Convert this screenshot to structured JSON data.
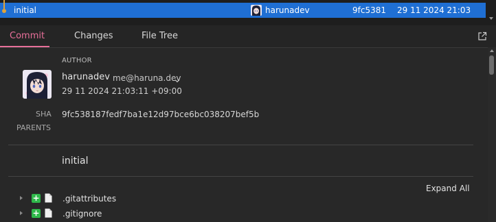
{
  "commit_row": {
    "subject": "initial",
    "author": "harunadev",
    "sha_short": "9fc5381",
    "date": "29 11 2024 21:03",
    "graph_color": "#e0a33a",
    "selection_color": "#1f6fd4"
  },
  "tabs": [
    {
      "label": "Commit",
      "active": true
    },
    {
      "label": "Changes",
      "active": false
    },
    {
      "label": "File Tree",
      "active": false
    }
  ],
  "accent_color": "#e8709a",
  "details": {
    "author_label": "AUTHOR",
    "author_name": "harunadev",
    "author_email": "me@haruna.dev",
    "author_date": "29 11 2024 21:03:11 +09:00",
    "sha_label": "SHA",
    "sha": "9fc538187fedf7ba1e12d97bce6bc038207bef5b",
    "parents_label": "PARENTS",
    "message": "initial"
  },
  "files": {
    "expand_all_label": "Expand All",
    "items": [
      {
        "name": ".gitattributes",
        "status_glyph": "+",
        "status": "added",
        "icon": "file-icon"
      },
      {
        "name": ".gitignore",
        "status_glyph": "+",
        "status": "added",
        "icon": "file-icon"
      }
    ],
    "added_color": "#2fb84a"
  },
  "icons": {
    "popout": "external-link-icon",
    "email_dropdown": "chevron-down-icon",
    "expand": "caret-right-icon"
  }
}
